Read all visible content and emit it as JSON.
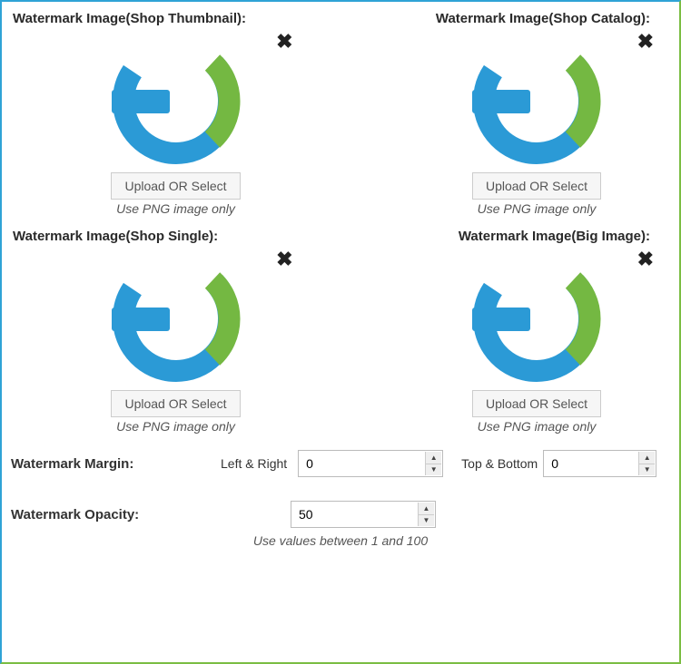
{
  "uploads": [
    {
      "id": "thumb",
      "title": "Watermark Image(Shop Thumbnail):",
      "button": "Upload OR Select",
      "hint": "Use PNG image only"
    },
    {
      "id": "catalog",
      "title": "Watermark Image(Shop Catalog):",
      "button": "Upload OR Select",
      "hint": "Use PNG image only"
    },
    {
      "id": "single",
      "title": "Watermark Image(Shop Single):",
      "button": "Upload OR Select",
      "hint": "Use PNG image only"
    },
    {
      "id": "big",
      "title": "Watermark Image(Big Image):",
      "button": "Upload OR Select",
      "hint": "Use PNG image only"
    }
  ],
  "margin": {
    "label": "Watermark Margin:",
    "left_right_label": "Left & Right",
    "left_right_value": "0",
    "top_bottom_label": "Top & Bottom",
    "top_bottom_value": "0"
  },
  "opacity": {
    "label": "Watermark Opacity:",
    "value": "50",
    "hint": "Use values between 1 and 100"
  }
}
